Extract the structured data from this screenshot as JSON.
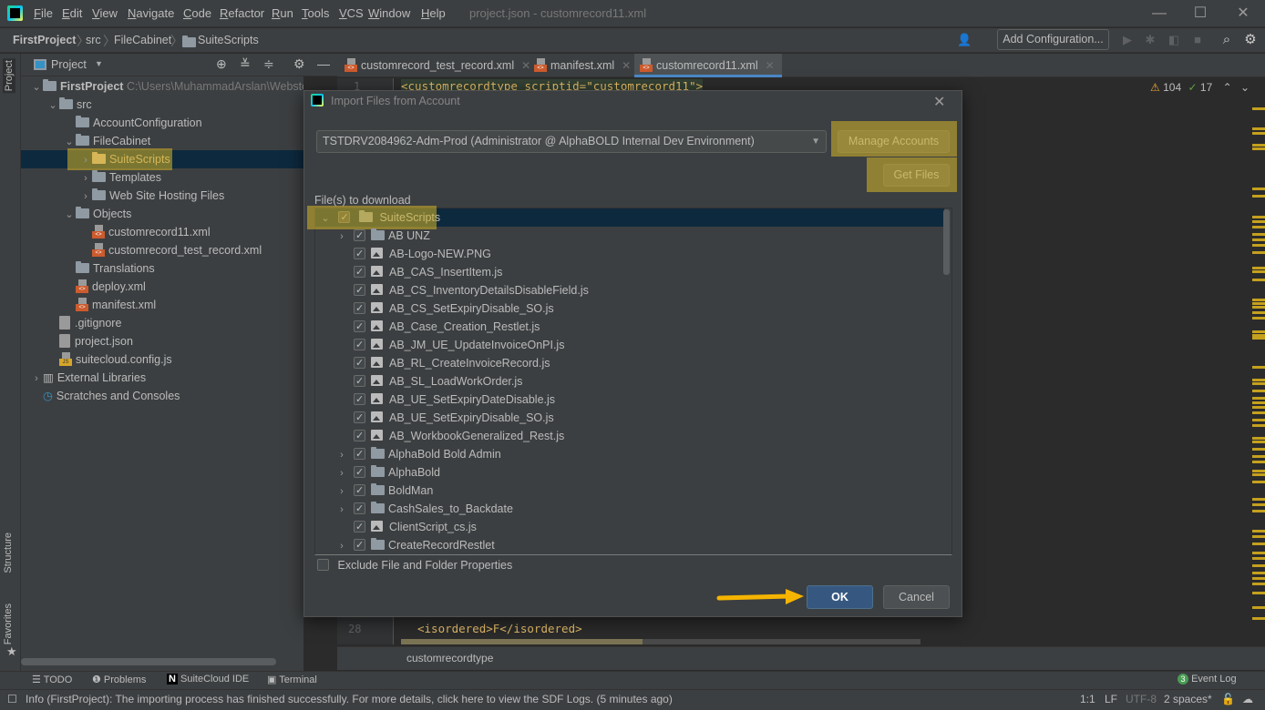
{
  "menu": {
    "items": [
      "File",
      "Edit",
      "View",
      "Navigate",
      "Code",
      "Refactor",
      "Run",
      "Tools",
      "VCS",
      "Window",
      "Help"
    ],
    "window_title": "project.json - customrecord11.xml"
  },
  "navbar": {
    "breadcrumbs": [
      "FirstProject",
      "src",
      "FileCabinet",
      "SuiteScripts"
    ],
    "add_configuration": "Add Configuration..."
  },
  "left_stripe": {
    "project": "Project",
    "structure": "Structure",
    "favorites": "Favorites"
  },
  "project_panel": {
    "title": "Project",
    "root_path": "C:\\Users\\MuhammadArslan\\WebstormProje",
    "tree": [
      {
        "label": "FirstProject",
        "type": "folder",
        "level": 0,
        "expanded": true
      },
      {
        "label": "src",
        "type": "folder",
        "level": 1,
        "expanded": true
      },
      {
        "label": "AccountConfiguration",
        "type": "folder",
        "level": 2
      },
      {
        "label": "FileCabinet",
        "type": "folder",
        "level": 2,
        "expanded": true
      },
      {
        "label": "SuiteScripts",
        "type": "folder",
        "level": 3,
        "selected": true
      },
      {
        "label": "Templates",
        "type": "folder",
        "level": 3
      },
      {
        "label": "Web Site Hosting Files",
        "type": "folder",
        "level": 3
      },
      {
        "label": "Objects",
        "type": "folder",
        "level": 2,
        "expanded": true
      },
      {
        "label": "customrecord11.xml",
        "type": "xml",
        "level": 3
      },
      {
        "label": "customrecord_test_record.xml",
        "type": "xml",
        "level": 3
      },
      {
        "label": "Translations",
        "type": "folder",
        "level": 2
      },
      {
        "label": "deploy.xml",
        "type": "xml",
        "level": 2
      },
      {
        "label": "manifest.xml",
        "type": "xml",
        "level": 2
      },
      {
        "label": ".gitignore",
        "type": "file",
        "level": 1
      },
      {
        "label": "project.json",
        "type": "file",
        "level": 1
      },
      {
        "label": "suitecloud.config.js",
        "type": "js",
        "level": 1
      },
      {
        "label": "External Libraries",
        "type": "lib",
        "level": 0
      },
      {
        "label": "Scratches and Consoles",
        "type": "scratch",
        "level": 0
      }
    ]
  },
  "editor": {
    "tabs": [
      {
        "label": "customrecord_test_record.xml",
        "active": false
      },
      {
        "label": "manifest.xml",
        "active": false
      },
      {
        "label": "customrecord11.xml",
        "active": true
      }
    ],
    "line1_no": "1",
    "line1": "<customrecordtype scriptid=\"customrecord11\">",
    "line28_no": "28",
    "line28": "<isordered>F</isordered>",
    "warnings": "104",
    "weak_warnings": "17",
    "breadcrumb": "customrecordtype"
  },
  "dialog": {
    "title": "Import Files from Account",
    "account": "TSTDRV2084962-Adm-Prod (Administrator @ AlphaBOLD Internal Dev Environment)",
    "manage_accounts": "Manage Accounts",
    "get_files": "Get Files",
    "files_label": "File(s) to download",
    "root": {
      "label": "SuiteScripts",
      "checked": true
    },
    "files": [
      {
        "label": "AB UNZ",
        "type": "folder",
        "checked": true
      },
      {
        "label": "AB-Logo-NEW.PNG",
        "type": "file",
        "checked": true
      },
      {
        "label": "AB_CAS_InsertItem.js",
        "type": "file",
        "checked": true
      },
      {
        "label": "AB_CS_InventoryDetailsDisableField.js",
        "type": "file",
        "checked": true
      },
      {
        "label": "AB_CS_SetExpiryDisable_SO.js",
        "type": "file",
        "checked": true
      },
      {
        "label": "AB_Case_Creation_Restlet.js",
        "type": "file",
        "checked": true
      },
      {
        "label": "AB_JM_UE_UpdateInvoiceOnPI.js",
        "type": "file",
        "checked": true
      },
      {
        "label": "AB_RL_CreateInvoiceRecord.js",
        "type": "file",
        "checked": true
      },
      {
        "label": "AB_SL_LoadWorkOrder.js",
        "type": "file",
        "checked": true
      },
      {
        "label": "AB_UE_SetExpiryDateDisable.js",
        "type": "file",
        "checked": true
      },
      {
        "label": "AB_UE_SetExpiryDisable_SO.js",
        "type": "file",
        "checked": true
      },
      {
        "label": "AB_WorkbookGeneralized_Rest.js",
        "type": "file",
        "checked": true
      },
      {
        "label": "AlphaBold Bold Admin",
        "type": "folder",
        "checked": true
      },
      {
        "label": "AlphaBold",
        "type": "folder",
        "checked": true
      },
      {
        "label": "BoldMan",
        "type": "folder",
        "checked": true
      },
      {
        "label": "CashSales_to_Backdate",
        "type": "folder",
        "checked": true
      },
      {
        "label": "ClientScript_cs.js",
        "type": "file",
        "checked": true
      },
      {
        "label": "CreateRecordRestlet",
        "type": "folder",
        "checked": true
      }
    ],
    "exclude_label": "Exclude File and Folder Properties",
    "exclude_checked": false,
    "ok": "OK",
    "cancel": "Cancel"
  },
  "toolwindows": {
    "todo": "TODO",
    "problems": "Problems",
    "suitecloud": "SuiteCloud IDE",
    "terminal": "Terminal",
    "event_log": "Event Log",
    "event_count": "3"
  },
  "status": {
    "message": "Info (FirstProject): The importing process has finished successfully. For more details, click here to view the SDF Logs. (5 minutes ago)",
    "position": "1:1",
    "line_sep": "LF",
    "encoding": "UTF-8",
    "indent": "2 spaces*"
  },
  "colors": {
    "highlight": "#d6b628",
    "accent": "#365880",
    "selection": "#0d293e",
    "arrow": "#f5b400"
  }
}
